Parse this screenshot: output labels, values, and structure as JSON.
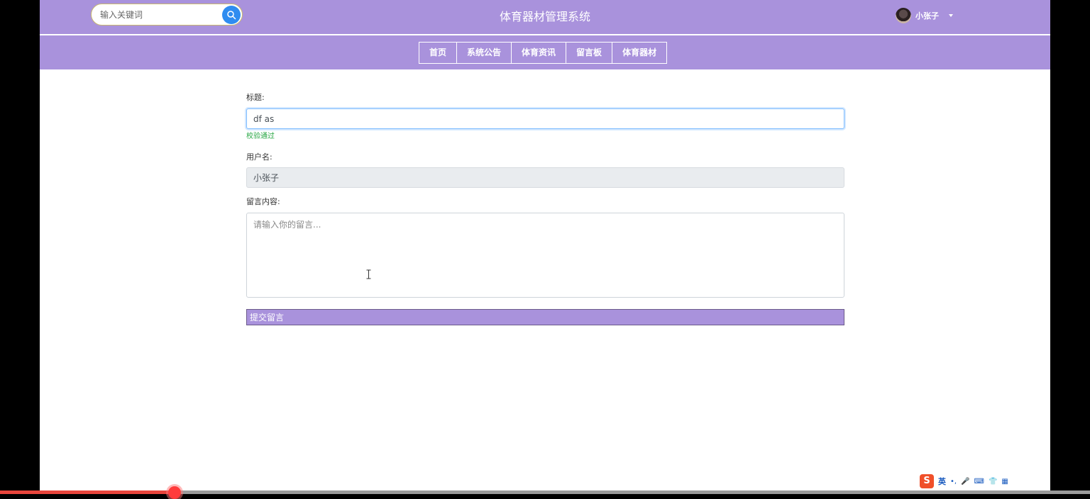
{
  "header": {
    "search_placeholder": "输入关键词",
    "site_title": "体育器材管理系统",
    "user_name": "小张子"
  },
  "nav": {
    "items": [
      "首页",
      "系统公告",
      "体育资讯",
      "留言板",
      "体育器材"
    ]
  },
  "form": {
    "title_label": "标题:",
    "title_value": "df as",
    "title_valid_text": "校验通过",
    "username_label": "用户名:",
    "username_value": "小张子",
    "content_label": "留言内容:",
    "content_placeholder": "请输入你的留言...",
    "submit_label": "提交留言"
  },
  "taskbar": {
    "ime_logo": "S",
    "ime_lang": "英",
    "ime_icons": [
      "•,",
      "🎤",
      "⌨",
      "👕",
      "▦"
    ]
  },
  "colors": {
    "brand": "#a992dc",
    "search_button": "#2f8cf0",
    "valid_text": "#28a745"
  }
}
